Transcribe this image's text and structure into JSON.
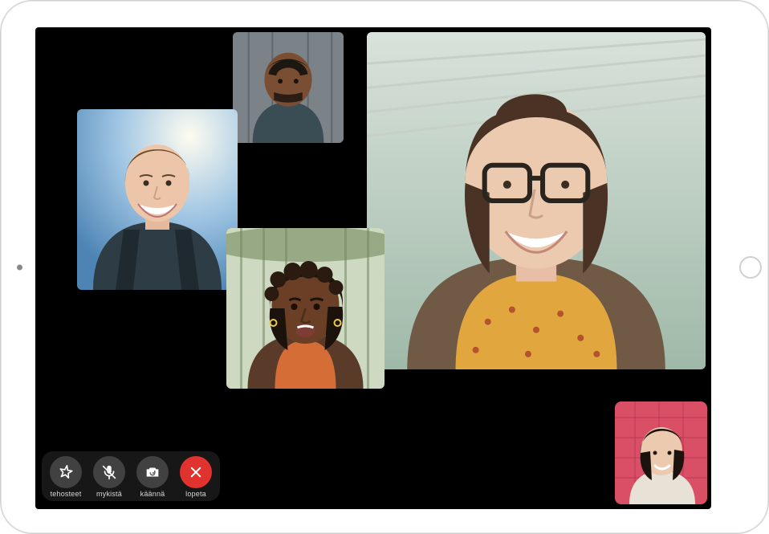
{
  "controls": {
    "effects_label": "tehosteet",
    "mute_label": "mykistä",
    "flip_label": "käännä",
    "end_label": "lopeta"
  },
  "participants": {
    "active_speaker": "participant-1",
    "count": 5
  },
  "colors": {
    "end_call": "#e0332f",
    "control_bg": "rgba(100,100,100,0.55)"
  }
}
